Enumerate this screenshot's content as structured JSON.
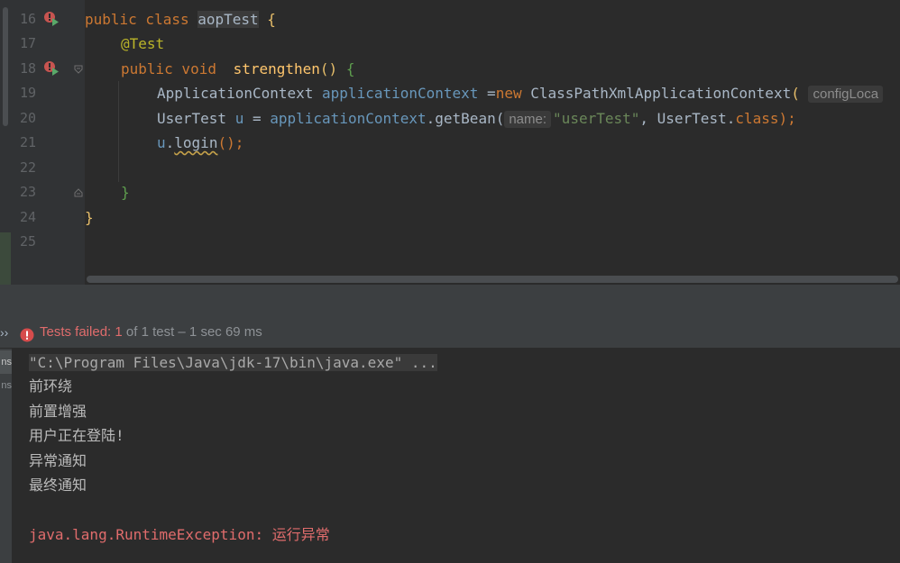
{
  "editor": {
    "line_numbers": [
      "16",
      "17",
      "18",
      "19",
      "20",
      "21",
      "22",
      "23",
      "24",
      "25"
    ],
    "line16": {
      "kw1": "public class ",
      "class_name": "aopTest",
      "brace": " {"
    },
    "line17": {
      "annotation": "@Test"
    },
    "line18": {
      "kw": "public void ",
      "method": "strengthen",
      "parens": "() ",
      "brace": "{"
    },
    "line19": {
      "type": "ApplicationContext ",
      "var": "applicationContext",
      "assign": " =",
      "kw": "new ",
      "ctor": "ClassPathXmlApplicationContext",
      "paren": "(",
      "hint": "configLoca"
    },
    "line20": {
      "type": "UserTest ",
      "var": "u",
      "assign": " = ",
      "ref": "applicationContext",
      "call": ".getBean(",
      "hint": "name:",
      "str": "\"userTest\"",
      "rest1": ", UserTest.",
      "kw": "class",
      "rest2": ");"
    },
    "line21": {
      "var": "u",
      "dot": ".",
      "method": "login",
      "rest": "();"
    },
    "line23": {
      "brace": "}"
    },
    "line24": {
      "brace": "}"
    }
  },
  "test_status": {
    "chevron": "››",
    "failed_label": "Tests failed: ",
    "failed_count": "1",
    "summary": " of 1 test – 1 sec 69 ms"
  },
  "console": {
    "side_tabs": [
      "ns",
      "ns"
    ],
    "command": "\"C:\\Program Files\\Java\\jdk-17\\bin\\java.exe\" ...",
    "output": [
      "前环绕",
      "前置增强",
      "用户正在登陆!",
      "异常通知",
      "最终通知"
    ],
    "exception": "java.lang.RuntimeException: 运行异常"
  },
  "colors": {
    "background": "#2b2b2b",
    "keyword": "#cc7832",
    "annotation": "#bbb529",
    "method": "#ffc66d",
    "field": "#6897bb",
    "string": "#6a8759",
    "error": "#e06c6c"
  }
}
